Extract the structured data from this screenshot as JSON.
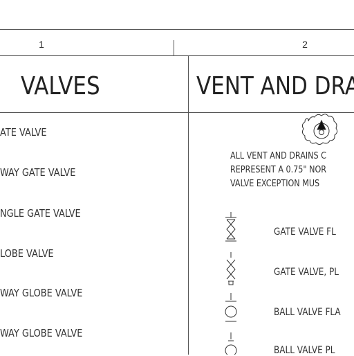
{
  "columns": {
    "col1": "1",
    "col2": "2"
  },
  "headings": {
    "valves": "VALVES",
    "vent_drains": "VENT AND DRA"
  },
  "valve_list": [
    "ATE VALVE",
    "WAY GATE VALVE",
    "NGLE GATE VALVE",
    "LOBE VALVE",
    "WAY GLOBE VALVE",
    "WAY GLOBE VALVE"
  ],
  "note_lines": [
    "ALL VENT AND DRAINS C",
    "REPRESENT A 0.75\" NOR",
    "VALVE EXCEPTION MUS"
  ],
  "legend": [
    {
      "icon": "gate-valve-flanged-icon",
      "label": "GATE VALVE FL"
    },
    {
      "icon": "gate-valve-plugged-icon",
      "label": "GATE VALVE, PL"
    },
    {
      "icon": "ball-valve-flanged-icon",
      "label": "BALL VALVE FLA"
    },
    {
      "icon": "ball-valve-plugged-icon",
      "label": "BALL VALVE PL"
    }
  ]
}
